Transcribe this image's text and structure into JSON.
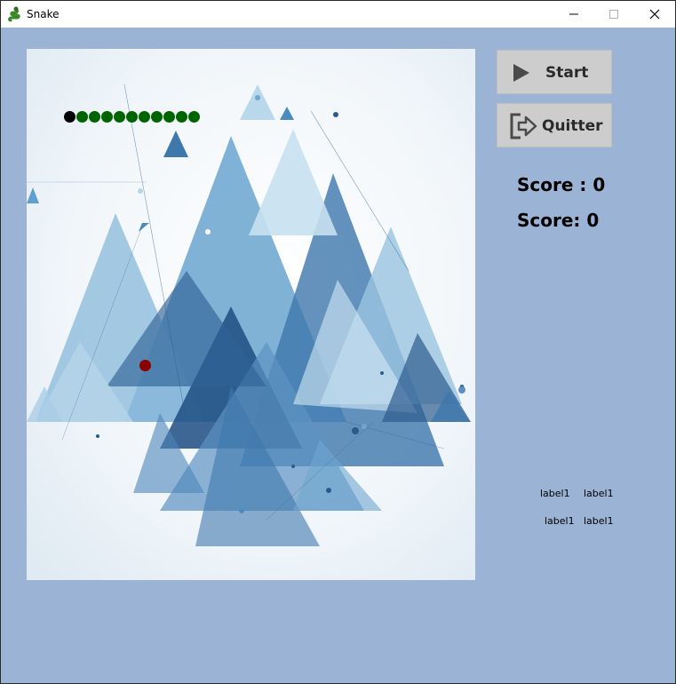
{
  "window": {
    "title": "Snake",
    "icon": "snake-icon",
    "controls": [
      "minimize-icon",
      "maximize-icon",
      "close-icon"
    ]
  },
  "colors": {
    "form_background": "#9bb3d4",
    "snake_head": "#000000",
    "snake_body": "#006400",
    "food": "#8b0000",
    "button_background": "#cdcdcd"
  },
  "game": {
    "snake_segments": 11,
    "background": "abstract blue triangles image"
  },
  "buttons": {
    "start_label": "Start",
    "start_icon": "play-icon",
    "quit_label": "Quitter",
    "quit_icon": "exit-icon"
  },
  "scores": {
    "score_1": "Score : 0",
    "score_2": "Score: 0"
  },
  "labels": {
    "a": "label1",
    "b": "label1",
    "c": "label1",
    "d": "label1"
  }
}
